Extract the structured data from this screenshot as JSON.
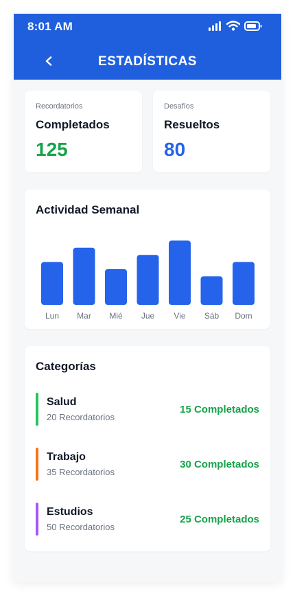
{
  "status_bar": {
    "time": "8:01 AM"
  },
  "header": {
    "title": "ESTADÍSTICAS"
  },
  "stats": [
    {
      "label": "Recordatorios",
      "title": "Completados",
      "value": "125",
      "color": "#16a34a"
    },
    {
      "label": "Desafíos",
      "title": "Resueltos",
      "value": "80",
      "color": "#2563eb"
    }
  ],
  "weekly": {
    "title": "Actividad Semanal"
  },
  "chart_data": {
    "type": "bar",
    "categories": [
      "Lun",
      "Mar",
      "Mié",
      "Jue",
      "Vie",
      "Sáb",
      "Dom"
    ],
    "values": [
      60,
      80,
      50,
      70,
      90,
      40,
      60
    ],
    "ylim": [
      0,
      100
    ],
    "grid": false,
    "bar_color": "#2563eb"
  },
  "categories": {
    "title": "Categorías",
    "items": [
      {
        "name": "Salud",
        "sub": "20 Recordatorios",
        "done": "15 Completados",
        "color": "#22c55e"
      },
      {
        "name": "Trabajo",
        "sub": "35 Recordatorios",
        "done": "30 Completados",
        "color": "#f97316"
      },
      {
        "name": "Estudios",
        "sub": "50 Recordatorios",
        "done": "25 Completados",
        "color": "#a855f7"
      }
    ],
    "done_color": "#16a34a"
  },
  "colors": {
    "header": "#1f5fde",
    "background": "#f6f7f9"
  }
}
